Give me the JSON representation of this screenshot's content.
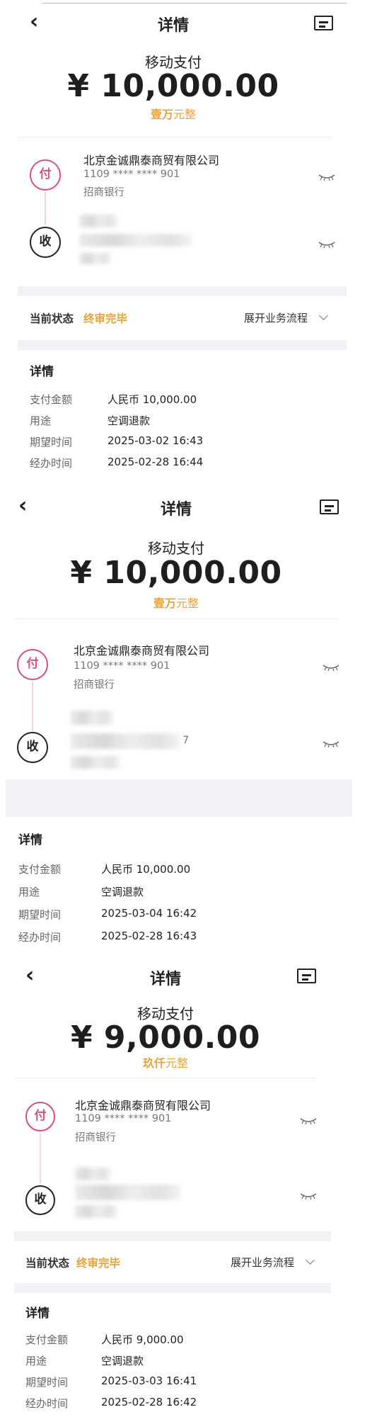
{
  "screens": [
    {
      "header": {
        "title": "详情"
      },
      "payment_type": "移动支付",
      "amount": "¥ 10,000.00",
      "amount_caps_highlight": "壹万",
      "amount_caps_suffix": "元整",
      "payer": {
        "badge": "付",
        "company": "北京金诚鼎泰商贸有限公司",
        "account": "1109 **** **** 901",
        "bank": "招商银行"
      },
      "payee": {
        "badge": "收",
        "account_tail": ""
      },
      "status": {
        "label": "当前状态",
        "value": "终审完毕",
        "expand": "展开业务流程"
      },
      "details": {
        "title": "详情",
        "rows": [
          {
            "k": "支付金额",
            "v": "人民币 10,000.00"
          },
          {
            "k": "用途",
            "v": "空调退款"
          },
          {
            "k": "期望时间",
            "v": "2025-03-02 16:43"
          },
          {
            "k": "经办时间",
            "v": "2025-02-28 16:44"
          }
        ]
      }
    },
    {
      "header": {
        "title": "详情"
      },
      "payment_type": "移动支付",
      "amount": "¥ 10,000.00",
      "amount_caps_highlight": "壹万",
      "amount_caps_suffix": "元整",
      "payer": {
        "badge": "付",
        "company": "北京金诚鼎泰商贸有限公司",
        "account": "1109 **** **** 901",
        "bank": "招商银行"
      },
      "payee": {
        "badge": "收",
        "account_tail": "7"
      },
      "details": {
        "title": "详情",
        "rows": [
          {
            "k": "支付金额",
            "v": "人民币 10,000.00"
          },
          {
            "k": "用途",
            "v": "空调退款"
          },
          {
            "k": "期望时间",
            "v": "2025-03-04 16:42"
          },
          {
            "k": "经办时间",
            "v": "2025-02-28 16:43"
          }
        ]
      }
    },
    {
      "header": {
        "title": "详情"
      },
      "payment_type": "移动支付",
      "amount": "¥ 9,000.00",
      "amount_caps_highlight": "玖仟",
      "amount_caps_suffix": "元整",
      "payer": {
        "badge": "付",
        "company": "北京金诚鼎泰商贸有限公司",
        "account": "1109 **** **** 901",
        "bank": "招商银行"
      },
      "payee": {
        "badge": "收",
        "account_tail": ""
      },
      "status": {
        "label": "当前状态",
        "value": "终审完毕",
        "expand": "展开业务流程"
      },
      "details": {
        "title": "详情",
        "rows": [
          {
            "k": "支付金额",
            "v": "人民币 9,000.00"
          },
          {
            "k": "用途",
            "v": "空调退款"
          },
          {
            "k": "期望时间",
            "v": "2025-03-03 16:41"
          },
          {
            "k": "经办时间",
            "v": "2025-02-28 16:42"
          }
        ]
      }
    }
  ],
  "colors": {
    "accent_orange": "#e8a23a",
    "pay_pink": "#d94f7c",
    "band_gray": "#f2f2f6"
  },
  "icons": {
    "back": "chevron-left-icon",
    "message": "message-icon",
    "eye": "eye-closed-icon",
    "expand": "chevron-down-icon"
  }
}
